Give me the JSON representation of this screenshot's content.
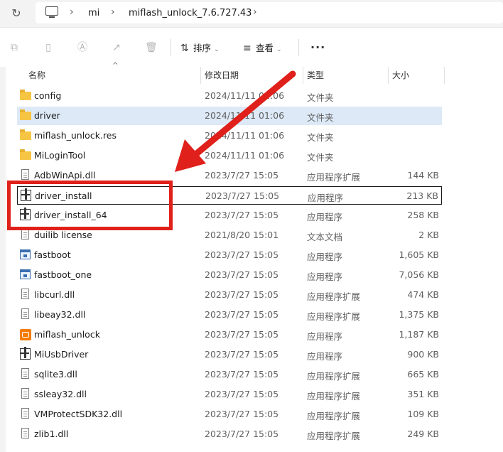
{
  "address_bar": {
    "crumbs": [
      "mi",
      "miflash_unlock_7.6.727.43"
    ],
    "sep": "›",
    "refresh_glyph": "↻"
  },
  "toolbar": {
    "sort_label": "排序",
    "view_label": "查看",
    "more_label": "···",
    "chevron": "⌄",
    "disabled_icons": [
      "copy-icon",
      "paste-icon",
      "rename-icon",
      "share-icon",
      "delete-icon"
    ]
  },
  "columns": {
    "name": "名称",
    "date": "修改日期",
    "type": "类型",
    "size": "大小"
  },
  "files": [
    {
      "name": "config",
      "date": "2024/11/11 01:06",
      "type": "文件夹",
      "size": "",
      "icon": "folder"
    },
    {
      "name": "driver",
      "date": "2024/11/11 01:06",
      "type": "文件夹",
      "size": "",
      "icon": "folder"
    },
    {
      "name": "miflash_unlock.res",
      "date": "2024/11/11 01:06",
      "type": "文件夹",
      "size": "",
      "icon": "folder"
    },
    {
      "name": "MiLoginTool",
      "date": "2024/11/11 01:06",
      "type": "文件夹",
      "size": "",
      "icon": "folder"
    },
    {
      "name": "AdbWinApi.dll",
      "date": "2023/7/27 15:05",
      "type": "应用程序扩展",
      "size": "144 KB",
      "icon": "doc"
    },
    {
      "name": "driver_install",
      "date": "2023/7/27 15:05",
      "type": "应用程序",
      "size": "213 KB",
      "icon": "installer"
    },
    {
      "name": "driver_install_64",
      "date": "2023/7/27 15:05",
      "type": "应用程序",
      "size": "258 KB",
      "icon": "installer"
    },
    {
      "name": "duilib license",
      "date": "2021/8/20 15:01",
      "type": "文本文档",
      "size": "2 KB",
      "icon": "doc"
    },
    {
      "name": "fastboot",
      "date": "2023/7/27 15:05",
      "type": "应用程序",
      "size": "1,605 KB",
      "icon": "exe"
    },
    {
      "name": "fastboot_one",
      "date": "2023/7/27 15:05",
      "type": "应用程序",
      "size": "7,056 KB",
      "icon": "exe"
    },
    {
      "name": "libcurl.dll",
      "date": "2023/7/27 15:05",
      "type": "应用程序扩展",
      "size": "474 KB",
      "icon": "doc"
    },
    {
      "name": "libeay32.dll",
      "date": "2023/7/27 15:05",
      "type": "应用程序扩展",
      "size": "1,375 KB",
      "icon": "doc"
    },
    {
      "name": "miflash_unlock",
      "date": "2023/7/27 15:05",
      "type": "应用程序",
      "size": "1,187 KB",
      "icon": "mi-app"
    },
    {
      "name": "MiUsbDriver",
      "date": "2023/7/27 15:05",
      "type": "应用程序",
      "size": "900 KB",
      "icon": "installer"
    },
    {
      "name": "sqlite3.dll",
      "date": "2023/7/27 15:05",
      "type": "应用程序扩展",
      "size": "665 KB",
      "icon": "doc"
    },
    {
      "name": "ssleay32.dll",
      "date": "2023/7/27 15:05",
      "type": "应用程序扩展",
      "size": "351 KB",
      "icon": "doc"
    },
    {
      "name": "VMProtectSDK32.dll",
      "date": "2023/7/27 15:05",
      "type": "应用程序扩展",
      "size": "109 KB",
      "icon": "doc"
    },
    {
      "name": "zlib1.dll",
      "date": "2023/7/27 15:05",
      "type": "应用程序扩展",
      "size": "249 KB",
      "icon": "doc"
    }
  ],
  "selected_row": "driver",
  "focused_row": "driver_install",
  "annotation": {
    "color": "#e0201a"
  }
}
